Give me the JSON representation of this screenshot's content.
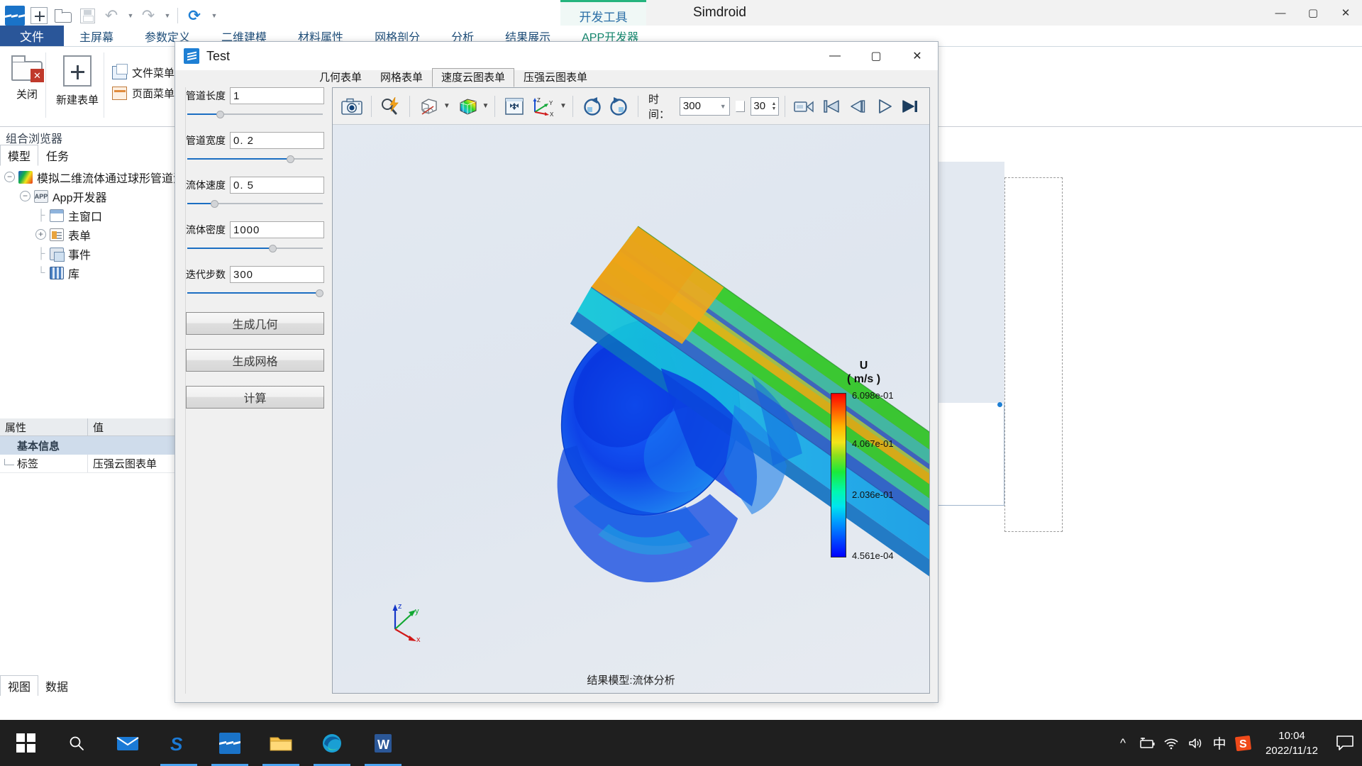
{
  "quick_access": {
    "items": [
      {
        "name": "app-logo",
        "label": "Simdroid"
      },
      {
        "name": "new",
        "label": "新建"
      },
      {
        "name": "open",
        "label": "打开"
      },
      {
        "name": "save",
        "label": "保存"
      },
      {
        "name": "undo",
        "label": "撤销"
      },
      {
        "name": "redo",
        "label": "重做"
      },
      {
        "name": "refresh",
        "label": "刷新"
      }
    ]
  },
  "window": {
    "brand_title": "Simdroid",
    "dev_tools_tab": "开发工具",
    "minimize": "—",
    "maximize": "▢",
    "close": "✕"
  },
  "ribbon": {
    "tabs": [
      {
        "label": "文件",
        "active": true
      },
      {
        "label": "主屏幕",
        "active": false
      },
      {
        "label": "参数定义",
        "active": false
      },
      {
        "label": "二维建模",
        "active": false
      },
      {
        "label": "材料属性",
        "active": false
      },
      {
        "label": "网格剖分",
        "active": false
      },
      {
        "label": "分析",
        "active": false
      },
      {
        "label": "结果展示",
        "active": false
      },
      {
        "label": "APP开发器",
        "active": false
      }
    ],
    "buttons": {
      "close": "关闭",
      "new_form": "新建表单",
      "file_menu": "文件菜单",
      "page_menu": "页面菜单"
    }
  },
  "browser": {
    "title": "组合浏览器",
    "tabs": [
      {
        "label": "模型",
        "active": true
      },
      {
        "label": "任务",
        "active": false
      }
    ],
    "tree": [
      {
        "label": "模拟二维流体通过球形管道流动",
        "icon": "model-icon",
        "depth": 0,
        "expander": "−"
      },
      {
        "label": "App开发器",
        "icon": "app-icon",
        "depth": 1,
        "expander": "−"
      },
      {
        "label": "主窗口",
        "icon": "window-icon",
        "depth": 2,
        "expander": ""
      },
      {
        "label": "表单",
        "icon": "form-icon",
        "depth": 2,
        "expander": "+"
      },
      {
        "label": "事件",
        "icon": "event-icon",
        "depth": 2,
        "expander": ""
      },
      {
        "label": "库",
        "icon": "library-icon",
        "depth": 2,
        "expander": ""
      }
    ]
  },
  "properties": {
    "headers": [
      "属性",
      "值"
    ],
    "group": "基本信息",
    "rows": [
      {
        "name": "标签",
        "value": "压强云图表单"
      }
    ]
  },
  "view_tabs": [
    {
      "label": "视图",
      "active": true
    },
    {
      "label": "数据",
      "active": false
    }
  ],
  "dialog": {
    "title": "Test",
    "minimize": "—",
    "maximize": "▢",
    "close": "✕",
    "tabs": [
      {
        "label": "几何表单",
        "active": false
      },
      {
        "label": "网格表单",
        "active": false
      },
      {
        "label": "速度云图表单",
        "active": true
      },
      {
        "label": "压强云图表单",
        "active": false
      }
    ],
    "parameters": [
      {
        "label": "管道长度",
        "value": "1",
        "slider_pct": 24
      },
      {
        "label": "管道宽度",
        "value": "0. 2",
        "slider_pct": 75
      },
      {
        "label": "流体速度",
        "value": "0. 5",
        "slider_pct": 20
      },
      {
        "label": "流体密度",
        "value": "1000",
        "slider_pct": 62
      },
      {
        "label": "迭代步数",
        "value": "300",
        "slider_pct": 97
      }
    ],
    "actions": [
      {
        "label": "生成几何",
        "name": "generate-geometry-button"
      },
      {
        "label": "生成网格",
        "name": "generate-mesh-button"
      },
      {
        "label": "计算",
        "name": "compute-button"
      }
    ],
    "viewer_toolbar": {
      "icons": [
        {
          "name": "screenshot-icon",
          "title": "截图"
        },
        {
          "name": "zoom-query-icon",
          "title": "快速缩放"
        },
        {
          "name": "visibility-icon",
          "title": "显示/隐藏"
        },
        {
          "name": "colormap-icon",
          "title": "云图"
        },
        {
          "name": "fit-view-icon",
          "title": "适应窗口"
        },
        {
          "name": "axis-orientation-icon",
          "title": "视角方位"
        },
        {
          "name": "rotate-cw-icon",
          "title": "顺时针旋转"
        },
        {
          "name": "rotate-ccw-icon",
          "title": "逆时针旋转"
        }
      ],
      "time_label": "时间：",
      "time_value": "300",
      "frame_value": "30",
      "playback": [
        {
          "name": "record-icon",
          "glyph": "▭"
        },
        {
          "name": "first-frame-icon",
          "glyph": "|◀"
        },
        {
          "name": "prev-frame-icon",
          "glyph": "◁|"
        },
        {
          "name": "play-icon",
          "glyph": "▷"
        },
        {
          "name": "last-frame-icon",
          "glyph": "▶|"
        }
      ]
    },
    "viewer_footer": "结果模型:流体分析",
    "legend": {
      "variable": "U",
      "unit": "( m/s )",
      "ticks": [
        "6.098e-01",
        "4.067e-01",
        "2.036e-01",
        "4.561e-04"
      ],
      "max": 0.6098,
      "min": 0.0004561
    },
    "axis_triad": {
      "x": "x",
      "y": "y",
      "z": "z"
    }
  },
  "taskbar": {
    "items": [
      {
        "name": "start-button",
        "glyph": "start"
      },
      {
        "name": "search-icon",
        "glyph": "search"
      },
      {
        "name": "mail-icon",
        "glyph": "mail"
      },
      {
        "name": "simdroid-taskbar-icon",
        "glyph": "S",
        "active": true
      },
      {
        "name": "simdroid-dev-taskbar-icon",
        "glyph": "book",
        "active": true
      },
      {
        "name": "file-explorer-icon",
        "glyph": "folder",
        "active": true
      },
      {
        "name": "edge-icon",
        "glyph": "edge",
        "active": true
      },
      {
        "name": "word-icon",
        "glyph": "W",
        "active": true
      }
    ],
    "tray": {
      "chevron": "^",
      "battery": "battery-icon",
      "wifi": "wifi-icon",
      "volume": "volume-icon",
      "ime": "中",
      "sogou": "S",
      "time": "10:04",
      "date": "2022/11/12",
      "notifications": "notification-icon"
    }
  },
  "colors": {
    "accent": "#2a5699",
    "ribbon_green": "#24b47e",
    "slider_fill": "#1b6ec2",
    "taskbar": "#1f1f1f"
  }
}
